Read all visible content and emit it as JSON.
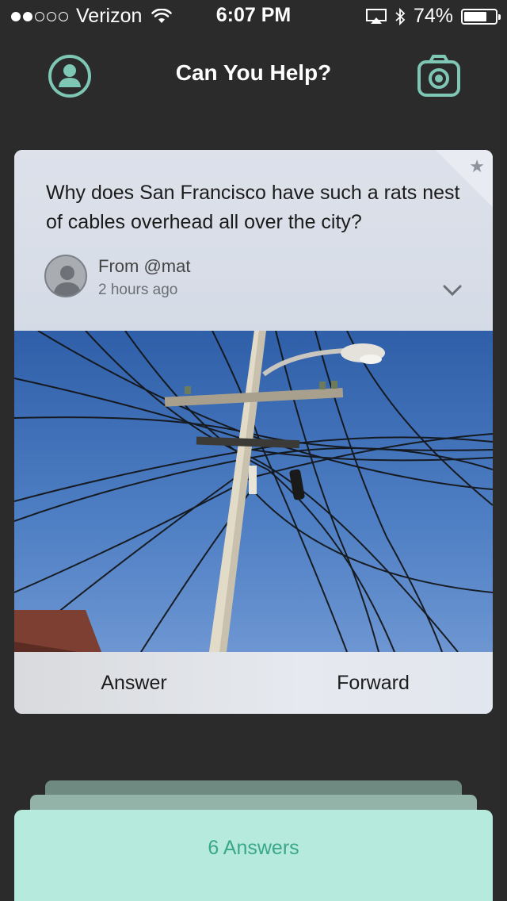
{
  "status_bar": {
    "carrier": "Verizon",
    "signal_strength": 2,
    "signal_total": 5,
    "time": "6:07 PM",
    "battery": "74%",
    "battery_level": 0.74
  },
  "nav": {
    "title": "Can You Help?",
    "left_icon": "profile-icon",
    "right_icon": "camera-icon",
    "accent_color": "#7fc7b5"
  },
  "question_card": {
    "question": "Why does San Francisco have such a rats nest of cables overhead all over the city?",
    "from": "From @mat",
    "posted": "2 hours ago",
    "star_icon": "star-icon",
    "expand_icon": "chevron-down-icon",
    "photo": "utility pole with overhead cables against blue sky",
    "actions": {
      "answer": "Answer",
      "forward": "Forward"
    }
  },
  "answers": {
    "label": "6 Answers",
    "card_color": "#b5eadc",
    "text_color": "#3aa78a"
  }
}
